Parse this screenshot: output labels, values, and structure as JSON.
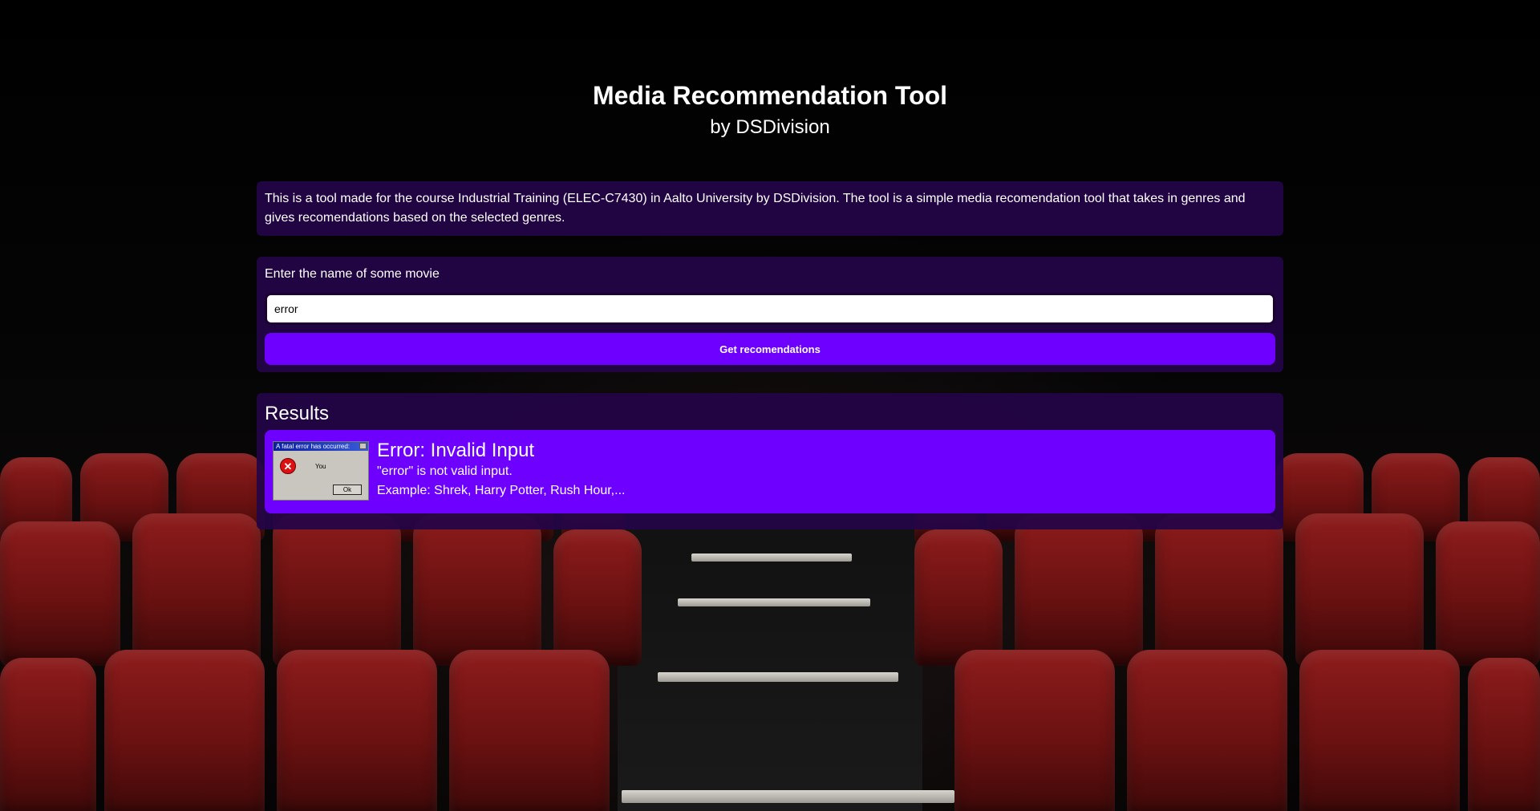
{
  "header": {
    "title": "Media Recommendation Tool",
    "subtitle": "by DSDivision"
  },
  "description": "This is a tool made for the course Industrial Training (ELEC-C7430) in Aalto University by DSDivision. The tool is a simple media recomendation tool that takes in genres and gives recomendations based on the selected genres.",
  "search": {
    "label": "Enter the name of some movie",
    "value": "error",
    "button_label": "Get recomendations"
  },
  "results": {
    "title": "Results",
    "card": {
      "thumbnail": {
        "dialog_title": "A fatal error has occurred:",
        "message": "You",
        "ok_label": "Ok",
        "icon": "error-x-icon"
      },
      "title": "Error: Invalid Input",
      "line1": "\"error\" is not valid input.",
      "line2": "Example: Shrek, Harry Potter, Rush Hour,..."
    }
  },
  "colors": {
    "panel": "#240448",
    "accent": "#6e00ff",
    "seat": "#8e1c1c"
  }
}
